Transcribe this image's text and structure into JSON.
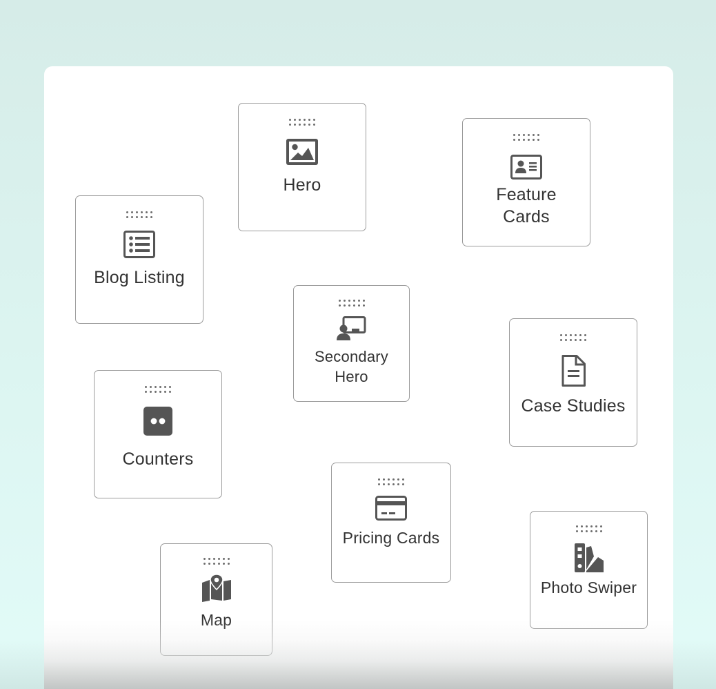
{
  "blocks": [
    {
      "id": "hero",
      "label": "Hero",
      "icon": "image-icon"
    },
    {
      "id": "feature-cards",
      "label": "Feature Cards",
      "icon": "id-card-icon"
    },
    {
      "id": "blog-listing",
      "label": "Blog Listing",
      "icon": "list-icon"
    },
    {
      "id": "secondary-hero",
      "label": "Secondary Hero",
      "icon": "presenter-icon"
    },
    {
      "id": "case-studies",
      "label": "Case Studies",
      "icon": "document-icon"
    },
    {
      "id": "counters",
      "label": "Counters",
      "icon": "counter-icon"
    },
    {
      "id": "pricing-cards",
      "label": "Pricing Cards",
      "icon": "credit-card-icon"
    },
    {
      "id": "photo-swiper",
      "label": "Photo Swiper",
      "icon": "swatchbook-icon"
    },
    {
      "id": "map",
      "label": "Map",
      "icon": "map-icon"
    }
  ],
  "colors": {
    "background": "#d6ece8",
    "panel": "#ffffff",
    "border": "#9b9b9b",
    "icon": "#555555",
    "text": "#333333"
  }
}
